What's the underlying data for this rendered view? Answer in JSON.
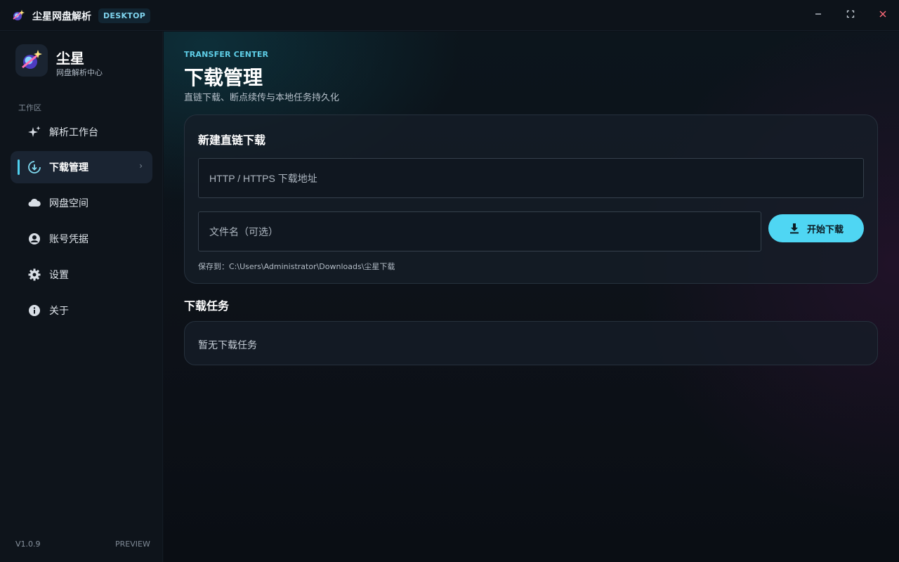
{
  "titlebar": {
    "app_title": "尘星网盘解析",
    "badge": "DESKTOP",
    "minimize_icon": "minimize-icon",
    "maximize_icon": "maximize-icon",
    "close_icon": "close-icon"
  },
  "sidebar": {
    "brand_name": "尘星",
    "brand_sub": "网盘解析中心",
    "section_label": "工作区",
    "items": [
      {
        "label": "解析工作台",
        "icon": "sparkle-icon",
        "active": false
      },
      {
        "label": "下载管理",
        "icon": "download-circle-icon",
        "active": true
      },
      {
        "label": "网盘空间",
        "icon": "cloud-icon",
        "active": false
      },
      {
        "label": "账号凭据",
        "icon": "account-icon",
        "active": false
      },
      {
        "label": "设置",
        "icon": "gear-icon",
        "active": false
      },
      {
        "label": "关于",
        "icon": "info-icon",
        "active": false
      }
    ],
    "version": "V1.0.9",
    "preview": "PREVIEW"
  },
  "main": {
    "overline": "TRANSFER CENTER",
    "title": "下载管理",
    "subtitle": "直链下载、断点续传与本地任务持久化",
    "new_download": {
      "title": "新建直链下载",
      "url_placeholder": "HTTP / HTTPS 下载地址",
      "filename_placeholder": "文件名（可选）",
      "start_label": "开始下载",
      "save_path": "保存到：C:\\Users\\Administrator\\Downloads\\尘星下载"
    },
    "tasks": {
      "title": "下载任务",
      "empty_text": "暂无下载任务"
    }
  },
  "colors": {
    "accent": "#4fd6f3",
    "background": "#0c1118",
    "card": "#161e28"
  }
}
